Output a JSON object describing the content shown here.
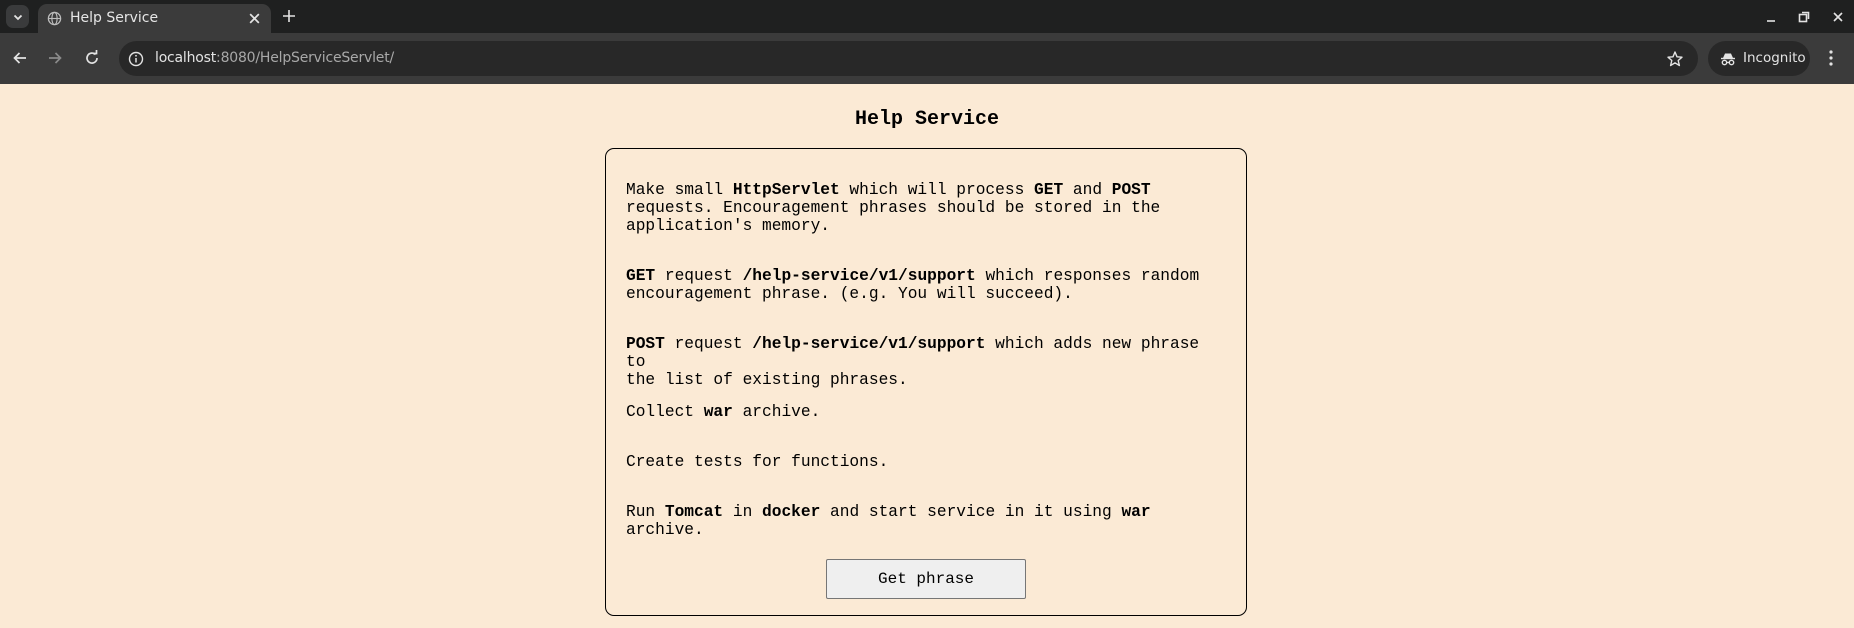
{
  "browser": {
    "tab_title": "Help Service",
    "url_host": "localhost",
    "url_rest": ":8080/HelpServiceServlet/",
    "incognito_label": "Incognito",
    "icons": [
      "chevron-down-icon",
      "globe-icon",
      "close-icon",
      "plus-icon",
      "minimize-icon",
      "restore-icon",
      "close-window-icon",
      "back-arrow-icon",
      "forward-arrow-icon",
      "reload-icon",
      "info-icon",
      "star-icon",
      "incognito-icon",
      "kebab-menu-icon"
    ]
  },
  "page": {
    "title": "Help Service",
    "paragraphs": [
      [
        {
          "t": "Make small ",
          "b": false
        },
        {
          "t": "HttpServlet",
          "b": true
        },
        {
          "t": " which will process ",
          "b": false
        },
        {
          "t": "GET",
          "b": true
        },
        {
          "t": " and ",
          "b": false
        },
        {
          "t": "POST",
          "b": true
        },
        {
          "t": "\nrequests. Encouragement phrases should be stored in the\napplication's memory.",
          "b": false
        }
      ],
      [
        {
          "t": "GET",
          "b": true
        },
        {
          "t": " request ",
          "b": false
        },
        {
          "t": "/help-service/v1/support",
          "b": true
        },
        {
          "t": " which responses random\nencouragement phrase. (e.g. You will succeed).",
          "b": false
        }
      ],
      [
        {
          "t": "POST",
          "b": true
        },
        {
          "t": " request ",
          "b": false
        },
        {
          "t": "/help-service/v1/support",
          "b": true
        },
        {
          "t": " which adds new phrase to\nthe list of existing phrases.",
          "b": false
        }
      ],
      [
        {
          "t": "Collect ",
          "b": false
        },
        {
          "t": "war",
          "b": true
        },
        {
          "t": " archive.",
          "b": false
        }
      ],
      [
        {
          "t": "Create tests for functions.",
          "b": false
        }
      ],
      [
        {
          "t": "Run ",
          "b": false
        },
        {
          "t": "Tomcat",
          "b": true
        },
        {
          "t": " in ",
          "b": false
        },
        {
          "t": "docker",
          "b": true
        },
        {
          "t": " and start service in it using ",
          "b": false
        },
        {
          "t": "war",
          "b": true
        },
        {
          "t": "\narchive.",
          "b": false
        }
      ]
    ],
    "button_label": "Get phrase"
  }
}
